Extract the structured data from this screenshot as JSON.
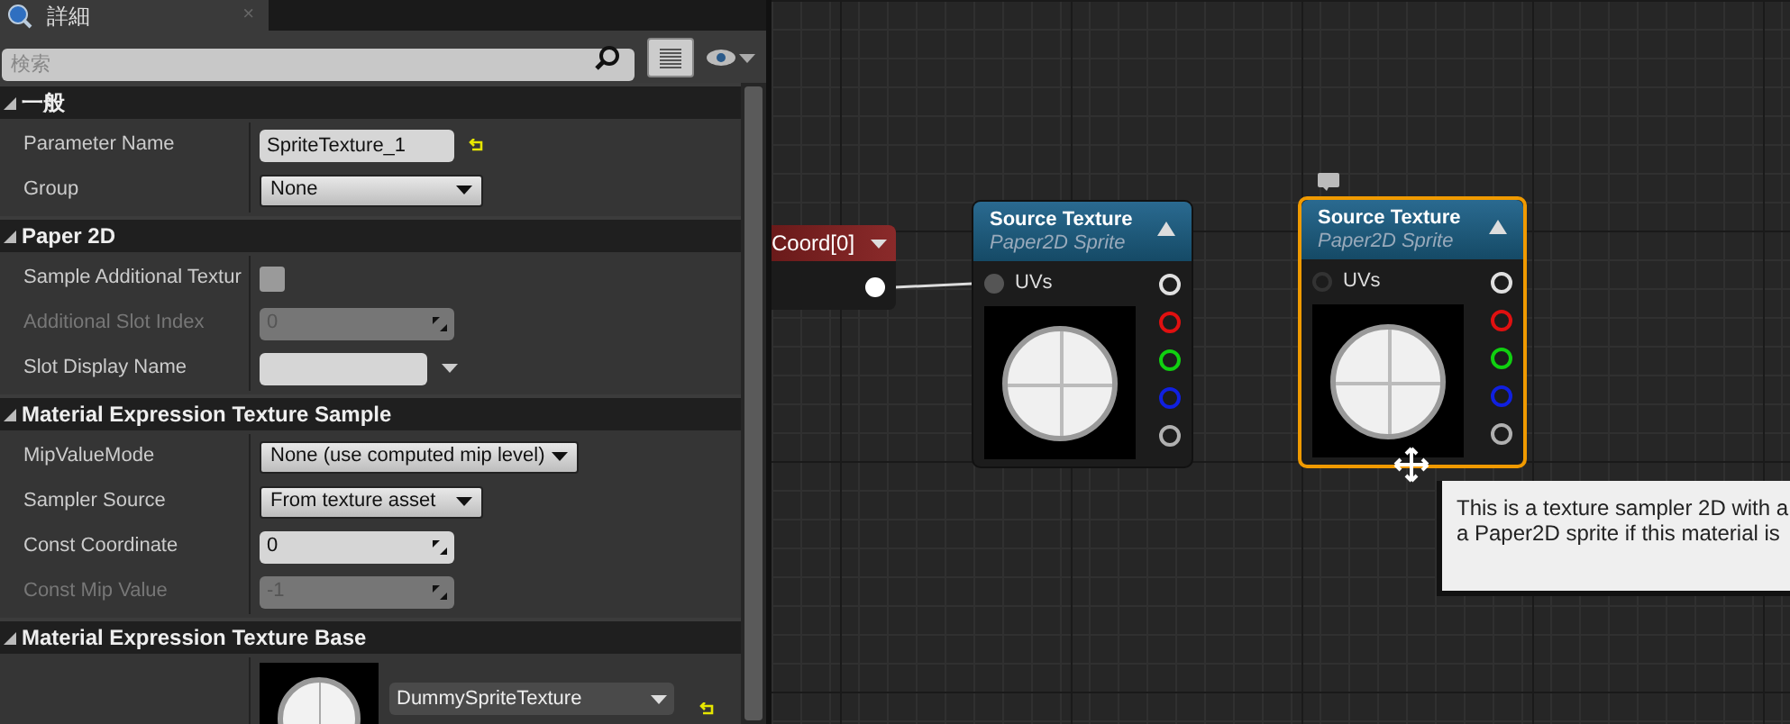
{
  "tab": {
    "title": "詳細",
    "close": "×"
  },
  "search": {
    "placeholder": "検索"
  },
  "sections": [
    {
      "title": "一般",
      "expanded": true,
      "rows": [
        {
          "kind": "text",
          "label": "Parameter Name",
          "value": "SpriteTexture_1",
          "disabled": false,
          "reset": true
        },
        {
          "kind": "dropdown",
          "label": "Group",
          "value": "None",
          "disabled": false,
          "reset": false
        }
      ]
    },
    {
      "title": "Paper 2D",
      "expanded": true,
      "rows": [
        {
          "kind": "checkbox",
          "label": "Sample Additional Textur",
          "checked": false,
          "disabled": false,
          "reset": false
        },
        {
          "kind": "number",
          "label": "Additional Slot Index",
          "value": "0",
          "disabled": true,
          "reset": false
        },
        {
          "kind": "combo",
          "label": "Slot Display Name",
          "disabled": false,
          "reset": false
        }
      ]
    },
    {
      "title": "Material Expression Texture Sample",
      "expanded": true,
      "rows": [
        {
          "kind": "dropdown",
          "label": "MipValueMode",
          "value": "None (use computed mip level)",
          "disabled": false,
          "reset": false
        },
        {
          "kind": "dropdown",
          "label": "Sampler Source",
          "value": "From texture asset",
          "disabled": false,
          "reset": false
        },
        {
          "kind": "number",
          "label": "Const Coordinate",
          "value": "0",
          "disabled": false,
          "reset": false
        },
        {
          "kind": "number",
          "label": "Const Mip Value",
          "value": "-1",
          "disabled": true,
          "reset": false
        }
      ]
    },
    {
      "title": "Material Expression Texture Base",
      "expanded": true,
      "rows": [
        {
          "kind": "asset",
          "value": "DummySpriteTexture",
          "disabled": false,
          "reset": true
        }
      ]
    }
  ],
  "graph": {
    "nodes": [
      {
        "kind": "partial",
        "title": "Coord[0]",
        "selected": false
      },
      {
        "kind": "texture",
        "title": "Source Texture",
        "subtitle": "Paper2D Sprite",
        "selected": false,
        "input": {
          "label": "UVs",
          "connected": true
        },
        "outputs": [
          {
            "color": "#e0e0e0"
          },
          {
            "color": "#e01010"
          },
          {
            "color": "#10d010"
          },
          {
            "color": "#1020e0"
          },
          {
            "color": "#b0b0b0"
          }
        ]
      },
      {
        "kind": "texture",
        "title": "Source Texture",
        "subtitle": "Paper2D Sprite",
        "selected": true,
        "input": {
          "label": "UVs",
          "connected": false
        },
        "outputs": [
          {
            "color": "#e0e0e0"
          },
          {
            "color": "#e01010"
          },
          {
            "color": "#10d010"
          },
          {
            "color": "#1020e0"
          },
          {
            "color": "#b0b0b0"
          }
        ]
      }
    ],
    "tooltip": [
      "This is a texture sampler 2D with a",
      "a Paper2D sprite if this material is"
    ]
  }
}
